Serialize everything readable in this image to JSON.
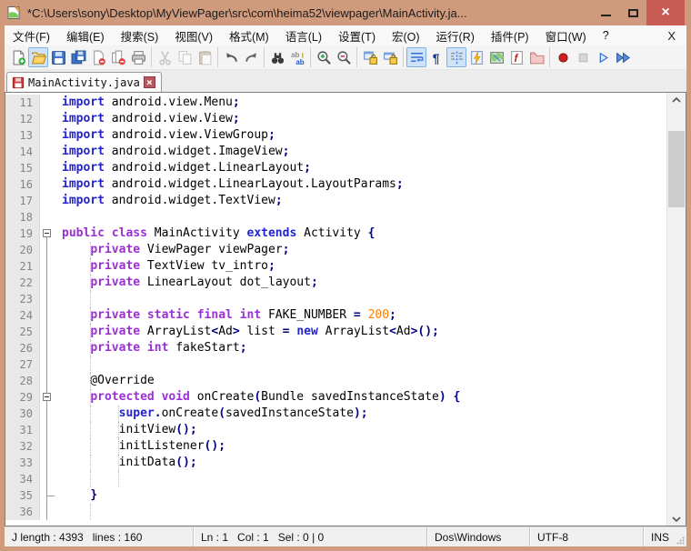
{
  "window": {
    "title": "*C:\\Users\\sony\\Desktop\\MyViewPager\\src\\com\\heima52\\viewpager\\MainActivity.ja...",
    "controls": {
      "minimize": "",
      "maximize": "",
      "close": "×"
    }
  },
  "colors": {
    "frame": "#d09a7c",
    "close_button": "#c85c55",
    "keyword_blue": "#2323cc",
    "keyword_purple": "#9a2fd6",
    "operator": "#000080",
    "number": "#ff8000"
  },
  "menu": {
    "items": [
      {
        "key": "file",
        "label": "文件(F)"
      },
      {
        "key": "edit",
        "label": "编辑(E)"
      },
      {
        "key": "search",
        "label": "搜索(S)"
      },
      {
        "key": "view",
        "label": "视图(V)"
      },
      {
        "key": "format",
        "label": "格式(M)"
      },
      {
        "key": "language",
        "label": "语言(L)"
      },
      {
        "key": "settings",
        "label": "设置(T)"
      },
      {
        "key": "macro",
        "label": "宏(O)"
      },
      {
        "key": "run",
        "label": "运行(R)"
      },
      {
        "key": "plugins",
        "label": "插件(P)"
      },
      {
        "key": "window",
        "label": "窗口(W)"
      },
      {
        "key": "help",
        "label": "?"
      }
    ],
    "close_x": "X"
  },
  "toolbar": {
    "groups": [
      [
        {
          "n": "new-file"
        },
        {
          "n": "open-file",
          "s": "hover"
        },
        {
          "n": "save"
        },
        {
          "n": "save-all"
        },
        {
          "n": "close-doc"
        },
        {
          "n": "close-all"
        },
        {
          "n": "print"
        }
      ],
      [
        {
          "n": "cut",
          "s": "disabled"
        },
        {
          "n": "copy",
          "s": "disabled"
        },
        {
          "n": "paste",
          "s": "disabled"
        }
      ],
      [
        {
          "n": "undo"
        },
        {
          "n": "redo"
        }
      ],
      [
        {
          "n": "find"
        },
        {
          "n": "replace"
        }
      ],
      [
        {
          "n": "zoom-in"
        },
        {
          "n": "zoom-out"
        }
      ],
      [
        {
          "n": "sync-vertical"
        },
        {
          "n": "sync-horizontal"
        }
      ],
      [
        {
          "n": "word-wrap",
          "s": "active"
        },
        {
          "n": "show-all-chars"
        },
        {
          "n": "indent-guide",
          "s": "active"
        },
        {
          "n": "lightning-doc"
        },
        {
          "n": "doc-map"
        },
        {
          "n": "function-list"
        },
        {
          "n": "folder-workspace"
        }
      ],
      [
        {
          "n": "record-macro"
        },
        {
          "n": "stop-macro",
          "s": "disabled"
        },
        {
          "n": "play-macro"
        },
        {
          "n": "run-macro-multiple"
        }
      ]
    ]
  },
  "tab": {
    "label": "MainActivity.java",
    "close_glyph": "×",
    "modified": true
  },
  "editor": {
    "lines": [
      {
        "n": 11,
        "fold": "",
        "g": [],
        "s": [
          [
            "kb",
            "import"
          ],
          [
            "pl",
            " android.view.Menu"
          ],
          [
            "op",
            ";"
          ]
        ]
      },
      {
        "n": 12,
        "fold": "",
        "g": [],
        "s": [
          [
            "kb",
            "import"
          ],
          [
            "pl",
            " android.view.View"
          ],
          [
            "op",
            ";"
          ]
        ]
      },
      {
        "n": 13,
        "fold": "",
        "g": [],
        "s": [
          [
            "kb",
            "import"
          ],
          [
            "pl",
            " android.view.ViewGroup"
          ],
          [
            "op",
            ";"
          ]
        ]
      },
      {
        "n": 14,
        "fold": "",
        "g": [],
        "s": [
          [
            "kb",
            "import"
          ],
          [
            "pl",
            " android.widget.ImageView"
          ],
          [
            "op",
            ";"
          ]
        ]
      },
      {
        "n": 15,
        "fold": "",
        "g": [],
        "s": [
          [
            "kb",
            "import"
          ],
          [
            "pl",
            " android.widget.LinearLayout"
          ],
          [
            "op",
            ";"
          ]
        ]
      },
      {
        "n": 16,
        "fold": "",
        "g": [],
        "s": [
          [
            "kb",
            "import"
          ],
          [
            "pl",
            " android.widget.LinearLayout.LayoutParams"
          ],
          [
            "op",
            ";"
          ]
        ]
      },
      {
        "n": 17,
        "fold": "",
        "g": [],
        "s": [
          [
            "kb",
            "import"
          ],
          [
            "pl",
            " android.widget.TextView"
          ],
          [
            "op",
            ";"
          ]
        ]
      },
      {
        "n": 18,
        "fold": "",
        "g": [],
        "s": []
      },
      {
        "n": 19,
        "fold": "boxstart",
        "g": [],
        "s": [
          [
            "kp",
            "public class"
          ],
          [
            "pl",
            " MainActivity "
          ],
          [
            "kb",
            "extends"
          ],
          [
            "pl",
            " Activity "
          ],
          [
            "op",
            "{"
          ]
        ]
      },
      {
        "n": 20,
        "fold": "line",
        "g": [
          4
        ],
        "s": [
          [
            "pl",
            "    "
          ],
          [
            "kp",
            "private"
          ],
          [
            "pl",
            " ViewPager viewPager"
          ],
          [
            "op",
            ";"
          ]
        ]
      },
      {
        "n": 21,
        "fold": "line",
        "g": [
          4
        ],
        "s": [
          [
            "pl",
            "    "
          ],
          [
            "kp",
            "private"
          ],
          [
            "pl",
            " TextView tv_intro"
          ],
          [
            "op",
            ";"
          ]
        ]
      },
      {
        "n": 22,
        "fold": "line",
        "g": [
          4
        ],
        "s": [
          [
            "pl",
            "    "
          ],
          [
            "kp",
            "private"
          ],
          [
            "pl",
            " LinearLayout dot_layout"
          ],
          [
            "op",
            ";"
          ]
        ]
      },
      {
        "n": 23,
        "fold": "line",
        "g": [
          4
        ],
        "s": []
      },
      {
        "n": 24,
        "fold": "line",
        "g": [
          4
        ],
        "s": [
          [
            "pl",
            "    "
          ],
          [
            "kp",
            "private static final int"
          ],
          [
            "pl",
            " FAKE_NUMBER "
          ],
          [
            "op",
            "="
          ],
          [
            "pl",
            " "
          ],
          [
            "num",
            "200"
          ],
          [
            "op",
            ";"
          ]
        ]
      },
      {
        "n": 25,
        "fold": "line",
        "g": [
          4
        ],
        "s": [
          [
            "pl",
            "    "
          ],
          [
            "kp",
            "private"
          ],
          [
            "pl",
            " ArrayList"
          ],
          [
            "op",
            "<"
          ],
          [
            "pl",
            "Ad"
          ],
          [
            "op",
            ">"
          ],
          [
            "pl",
            " list "
          ],
          [
            "op",
            "="
          ],
          [
            "pl",
            " "
          ],
          [
            "kb",
            "new"
          ],
          [
            "pl",
            " ArrayList"
          ],
          [
            "op",
            "<"
          ],
          [
            "pl",
            "Ad"
          ],
          [
            "op",
            ">();"
          ]
        ]
      },
      {
        "n": 26,
        "fold": "line",
        "g": [
          4
        ],
        "s": [
          [
            "pl",
            "    "
          ],
          [
            "kp",
            "private int"
          ],
          [
            "pl",
            " fakeStart"
          ],
          [
            "op",
            ";"
          ]
        ]
      },
      {
        "n": 27,
        "fold": "line",
        "g": [
          4
        ],
        "s": []
      },
      {
        "n": 28,
        "fold": "line",
        "g": [
          4
        ],
        "s": [
          [
            "pl",
            "    @Override"
          ]
        ]
      },
      {
        "n": 29,
        "fold": "boxmid",
        "g": [
          4
        ],
        "s": [
          [
            "pl",
            "    "
          ],
          [
            "kp",
            "protected void"
          ],
          [
            "pl",
            " onCreate"
          ],
          [
            "op",
            "("
          ],
          [
            "pl",
            "Bundle savedInstanceState"
          ],
          [
            "op",
            ")"
          ],
          [
            "pl",
            " "
          ],
          [
            "op",
            "{"
          ]
        ]
      },
      {
        "n": 30,
        "fold": "line",
        "g": [
          4,
          8
        ],
        "s": [
          [
            "pl",
            "        "
          ],
          [
            "kb",
            "super"
          ],
          [
            "op",
            "."
          ],
          [
            "pl",
            "onCreate"
          ],
          [
            "op",
            "("
          ],
          [
            "pl",
            "savedInstanceState"
          ],
          [
            "op",
            ");"
          ]
        ]
      },
      {
        "n": 31,
        "fold": "line",
        "g": [
          4,
          8
        ],
        "s": [
          [
            "pl",
            "        initView"
          ],
          [
            "op",
            "();"
          ]
        ]
      },
      {
        "n": 32,
        "fold": "line",
        "g": [
          4,
          8
        ],
        "s": [
          [
            "pl",
            "        initListener"
          ],
          [
            "op",
            "();"
          ]
        ]
      },
      {
        "n": 33,
        "fold": "line",
        "g": [
          4,
          8
        ],
        "s": [
          [
            "pl",
            "        initData"
          ],
          [
            "op",
            "();"
          ]
        ]
      },
      {
        "n": 34,
        "fold": "line",
        "g": [
          4,
          8
        ],
        "s": []
      },
      {
        "n": 35,
        "fold": "tick",
        "g": [],
        "s": [
          [
            "pl",
            "    "
          ],
          [
            "op",
            "}"
          ]
        ]
      },
      {
        "n": 36,
        "fold": "line",
        "g": [
          4
        ],
        "s": []
      }
    ]
  },
  "status": {
    "doc_stats": "J length : 4393   lines : 160",
    "caret": "Ln : 1   Col : 1   Sel : 0 | 0",
    "eol": "Dos\\Windows",
    "encoding": "UTF-8",
    "typing_mode": "INS"
  }
}
